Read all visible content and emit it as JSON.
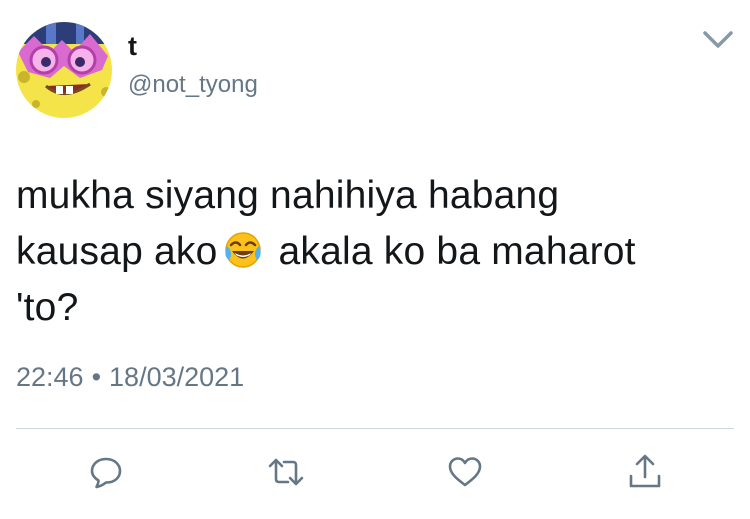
{
  "user": {
    "display_name": "t",
    "handle": "@not_tyong"
  },
  "tweet": {
    "text_line_1": "mukha siyang nahihiya habang",
    "text_line_2_start": "kausap ako",
    "emoji": "face-with-tears-of-joy",
    "text_line_2_end": "akala ko ba maharot",
    "text_line_3": "'to?"
  },
  "meta": {
    "time": "22:46",
    "separator": "•",
    "date": "18/03/2021"
  },
  "actions": {
    "reply_icon": "reply-icon",
    "retweet_icon": "retweet-icon",
    "like_icon": "like-icon",
    "share_icon": "share-icon"
  },
  "colors": {
    "text": "#14171a",
    "secondary": "#657786",
    "icon": "#657786",
    "divider": "#ccd6dd"
  }
}
